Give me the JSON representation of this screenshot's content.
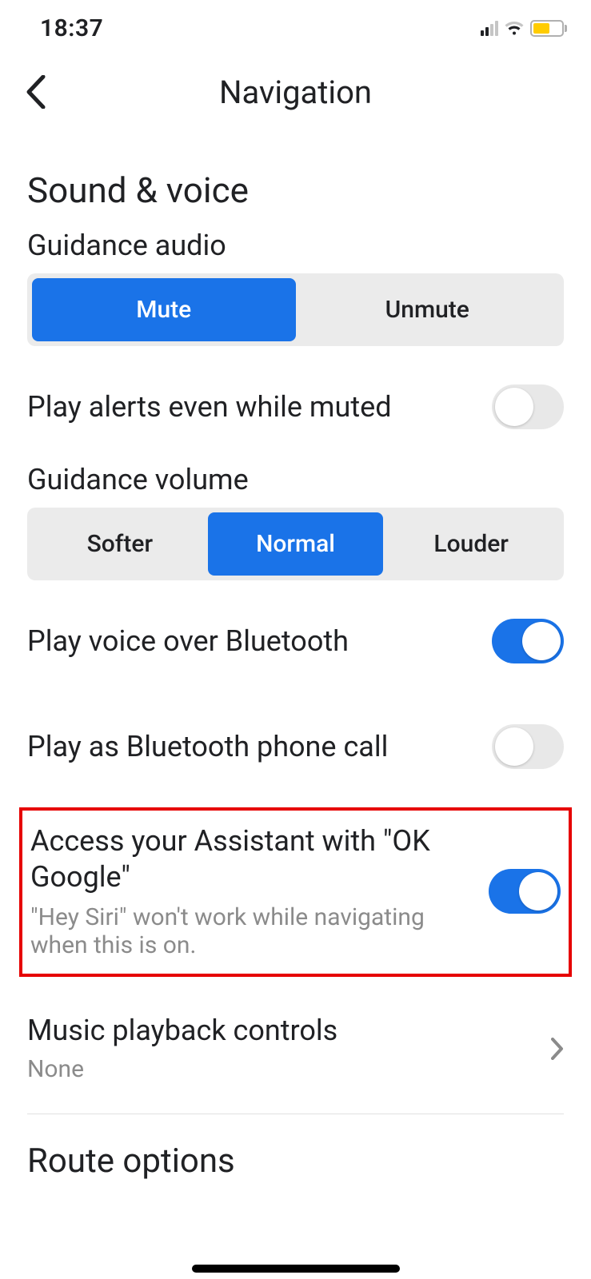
{
  "status_bar": {
    "time": "18:37"
  },
  "header": {
    "title": "Navigation"
  },
  "section": {
    "sound_voice_title": "Sound & voice",
    "guidance_audio_label": "Guidance audio",
    "guidance_audio_options": {
      "mute": "Mute",
      "unmute": "Unmute"
    },
    "play_alerts_label": "Play alerts even while muted",
    "guidance_volume_label": "Guidance volume",
    "guidance_volume_options": {
      "softer": "Softer",
      "normal": "Normal",
      "louder": "Louder"
    },
    "bluetooth_voice_label": "Play voice over Bluetooth",
    "bluetooth_call_label": "Play as Bluetooth phone call",
    "assistant_label": "Access your Assistant with \"OK Google\"",
    "assistant_sub": "\"Hey Siri\" won't work while navigating when this is on.",
    "music_label": "Music playback controls",
    "music_value": "None",
    "route_options_partial": "Route options"
  },
  "toggles": {
    "play_alerts": false,
    "bluetooth_voice": true,
    "bluetooth_call": false,
    "assistant": true
  },
  "colors": {
    "accent": "#1a73e8",
    "highlight_border": "#e60000",
    "battery_fill": "#ffcc00"
  }
}
